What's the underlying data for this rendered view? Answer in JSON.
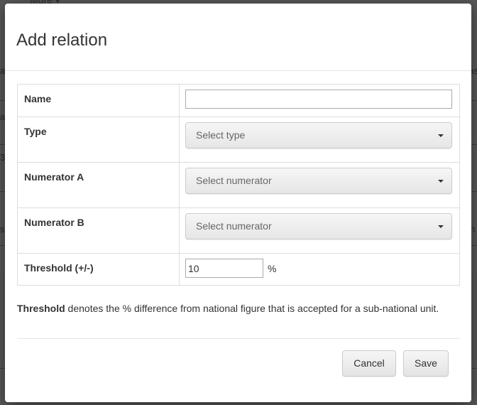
{
  "background": {
    "more_label": "More ▾",
    "fragments": [
      "a",
      "a",
      "3",
      "s",
      "as",
      "h"
    ]
  },
  "modal": {
    "title": "Add relation",
    "fields": {
      "name": {
        "label": "Name",
        "value": "",
        "placeholder": ""
      },
      "type": {
        "label": "Type",
        "placeholder": "Select type"
      },
      "numerator_a": {
        "label": "Numerator A",
        "placeholder": "Select numerator"
      },
      "numerator_b": {
        "label": "Numerator B",
        "placeholder": "Select numerator"
      },
      "threshold": {
        "label": "Threshold (+/-)",
        "value": "10",
        "unit": "%"
      }
    },
    "help": {
      "strong": "Threshold",
      "text": " denotes the % difference from national figure that is accepted for a sub-national unit."
    },
    "buttons": {
      "cancel": "Cancel",
      "save": "Save"
    }
  }
}
